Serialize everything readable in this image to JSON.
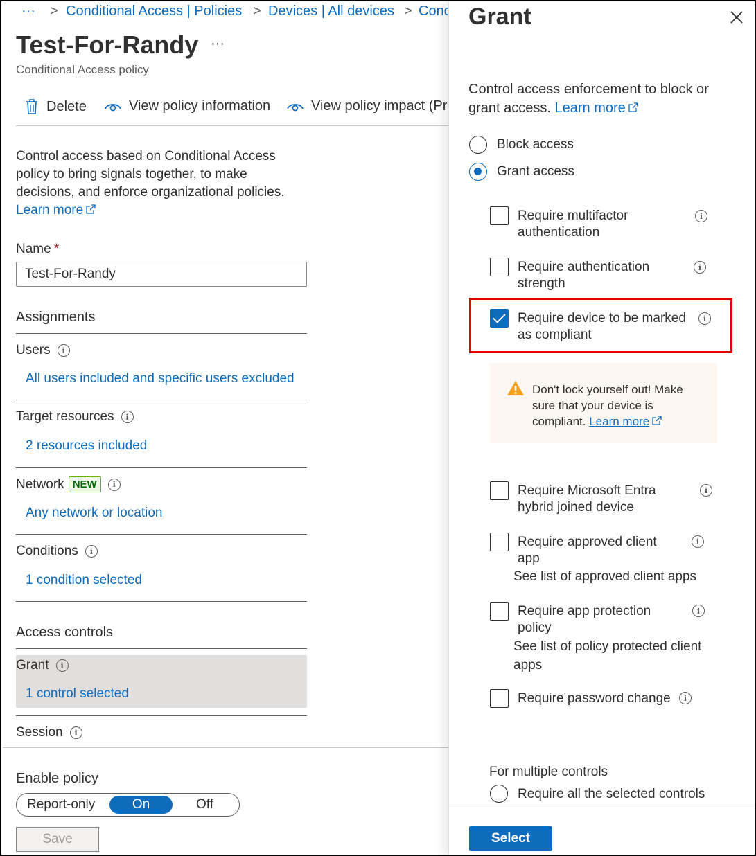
{
  "breadcrumb": {
    "ellipsis": "···",
    "items": [
      "Conditional Access | Policies",
      "Devices | All devices",
      "Cond"
    ],
    "separator": ">"
  },
  "header": {
    "title": "Test-For-Randy",
    "more": "···",
    "subtitle": "Conditional Access policy"
  },
  "toolbar": {
    "delete_label": "Delete",
    "view_info_label": "View policy information",
    "view_impact_label": "View policy impact (Pre"
  },
  "description": {
    "text": "Control access based on Conditional Access policy to bring signals together, to make decisions, and enforce organizational policies.",
    "learn_more": "Learn more"
  },
  "name_field": {
    "label": "Name",
    "required_mark": "*",
    "value": "Test-For-Randy"
  },
  "assignments": {
    "heading": "Assignments",
    "users": {
      "label": "Users",
      "value": "All users included and specific users excluded"
    },
    "target_resources": {
      "label": "Target resources",
      "value": "2 resources included"
    },
    "network": {
      "label": "Network",
      "badge": "NEW",
      "value": "Any network or location"
    },
    "conditions": {
      "label": "Conditions",
      "value": "1 condition selected"
    }
  },
  "access_controls": {
    "heading": "Access controls",
    "grant": {
      "label": "Grant",
      "value": "1 control selected"
    },
    "session": {
      "label": "Session"
    }
  },
  "enable_policy": {
    "label": "Enable policy",
    "options": [
      "Report-only",
      "On",
      "Off"
    ],
    "selected": "On"
  },
  "save_label": "Save",
  "grant_panel": {
    "title": "Grant",
    "intro": "Control access enforcement to block or grant access.",
    "learn_more": "Learn more",
    "block_access": "Block access",
    "grant_access": "Grant access",
    "selected_mode": "grant",
    "controls": [
      {
        "label": "Require multifactor authentication",
        "checked": false
      },
      {
        "label": "Require authentication strength",
        "checked": false
      },
      {
        "label": "Require device to be marked as compliant",
        "checked": true
      },
      {
        "label": "Require Microsoft Entra hybrid joined device",
        "checked": false
      },
      {
        "label": "Require approved client app",
        "checked": false,
        "link": "See list of approved client apps"
      },
      {
        "label": "Require app protection policy",
        "checked": false,
        "link": "See list of policy protected client apps"
      },
      {
        "label": "Require password change",
        "checked": false
      }
    ],
    "warning": {
      "text": "Don't lock yourself out! Make sure that your device is compliant.",
      "learn_more": "Learn more"
    },
    "multiple_controls": {
      "heading": "For multiple controls",
      "option_all": "Require all the selected controls"
    },
    "select_label": "Select",
    "colors": {
      "accent": "#0f6cbd",
      "highlight": "#e00000",
      "warning_bg": "#fdf6f1",
      "warning_icon": "#f7a21b"
    }
  }
}
